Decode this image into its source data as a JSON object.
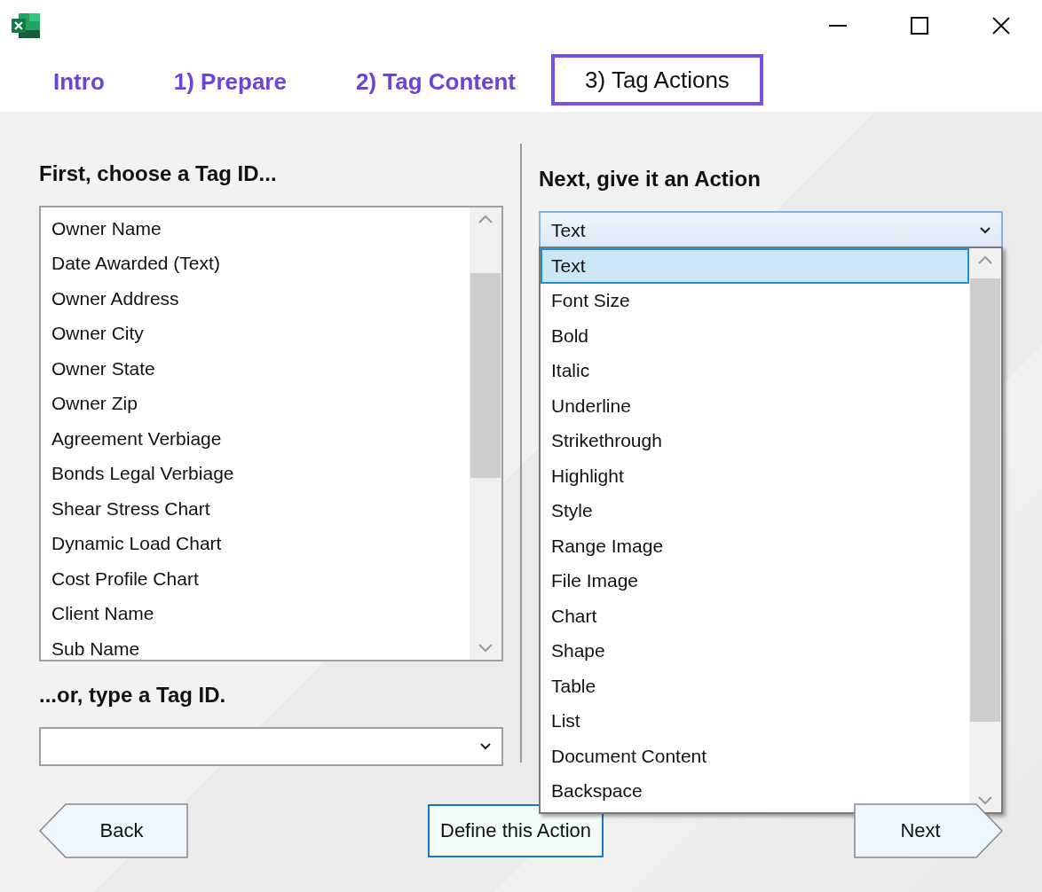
{
  "tabs": [
    {
      "label": "Intro",
      "selected": false
    },
    {
      "label": "1) Prepare",
      "selected": false
    },
    {
      "label": "2) Tag Content",
      "selected": false
    },
    {
      "label": "3) Tag Actions",
      "selected": true
    }
  ],
  "left": {
    "heading": "First, choose a Tag ID...",
    "items": [
      "Owner Name",
      "Date Awarded (Text)",
      "Owner Address",
      "Owner City",
      "Owner State",
      "Owner Zip",
      "Agreement Verbiage",
      "Bonds Legal Verbiage",
      "Shear Stress Chart",
      "Dynamic Load Chart",
      "Cost Profile Chart",
      "Client Name",
      "Sub Name"
    ],
    "type_heading": "...or, type a Tag ID."
  },
  "right": {
    "heading": "Next, give it an Action",
    "combo": {
      "value": "Text",
      "expanded": true
    },
    "options": [
      {
        "label": "Text",
        "selected": true
      },
      {
        "label": "Font Size",
        "selected": false
      },
      {
        "label": "Bold",
        "selected": false
      },
      {
        "label": "Italic",
        "selected": false
      },
      {
        "label": "Underline",
        "selected": false
      },
      {
        "label": "Strikethrough",
        "selected": false
      },
      {
        "label": "Highlight",
        "selected": false
      },
      {
        "label": "Style",
        "selected": false
      },
      {
        "label": "Range Image",
        "selected": false
      },
      {
        "label": "File Image",
        "selected": false
      },
      {
        "label": "Chart",
        "selected": false
      },
      {
        "label": "Shape",
        "selected": false
      },
      {
        "label": "Table",
        "selected": false
      },
      {
        "label": "List",
        "selected": false
      },
      {
        "label": "Document Content",
        "selected": false
      },
      {
        "label": "Backspace",
        "selected": false
      }
    ]
  },
  "buttons": {
    "back": "Back",
    "define": "Define this Action",
    "next": "Next"
  }
}
